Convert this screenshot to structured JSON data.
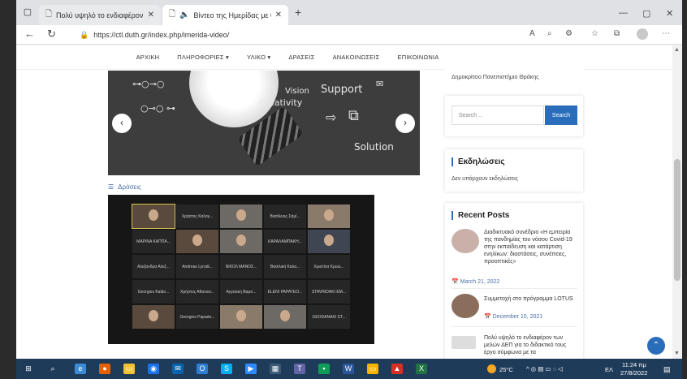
{
  "browser": {
    "tabs": [
      {
        "title": "Πολύ υψηλό το ενδιαφέρον τω",
        "active": false
      },
      {
        "title": "Βίντεο της Ημερίδας με θέ",
        "active": true
      }
    ],
    "url": "https://ctl.duth.gr/index.php/imerida-video/"
  },
  "menu": {
    "items": [
      "ΑΡΧΙΚΗ",
      "ΠΛΗΡΟΦΟΡΙΕΣ ▾",
      "ΥΛΙΚΟ ▾",
      "ΔΡΑΣΕΙΣ",
      "ΑΝΑΚΟΙΝΩΣΕΙΣ",
      "ΕΠΙΚΟΙΝΩΝΙΑ"
    ]
  },
  "slider": {
    "words": [
      "Vision",
      "Creativity",
      "Support",
      "Solution"
    ]
  },
  "content": {
    "category": "Δράσεις"
  },
  "video": {
    "participants": [
      "",
      "Χρήστος Καλογ...",
      "",
      "Βασίλειος Σαμί...",
      "",
      "ΜΑΡΙΝΑ ΚΑΠΠΑ...",
      "",
      "",
      "ΚΑΡΑΛΑΜΠΑΚΗ...",
      "",
      "Αλεξανδρα Αλεξ...",
      "Andreas Lyrodi...",
      "ΝΙΚΟΛ ΜΑΝΟΣ...",
      "Βασιλική Καλα...",
      "Χριστίνα Κρυώ...",
      "Georgios Kaibo...",
      "Χρήστος Αθανασ...",
      "Αγγελικη Βαρσ...",
      "ELENI PAPATEO...",
      "STAVRIDAKI EM...",
      "",
      "Georgios Papado...",
      "",
      "",
      "GEODANAKI ST..."
    ]
  },
  "sidebar": {
    "university": "Δημοκρίτειο Πανεπιστήμιο Θράκης",
    "search_placeholder": "Search ...",
    "search_button": "Search",
    "events_title": "Εκδηλώσεις",
    "events_text": "Δεν υπάρχουν εκδηλώσεις",
    "recent_title": "Recent Posts",
    "posts": [
      {
        "title": "Διαδικτυακό συνέδριο «Η εμπειρία της πανδημίας του νόσου Covid-19 στην εκπαίδευση και κατάρτιση ενηλίκων: διαστάσεις, συνέπειες, προοπτικές»",
        "date": "March 21, 2022"
      },
      {
        "title": "Συμμετοχή στο πρόγραμμα LOTUS",
        "date": "December 10, 2021"
      },
      {
        "title": "Πολύ υψηλό το ενδιαφέρον των μελών ΔΕΠ για το διδακτικό τους έργο σύμφωνα με τα",
        "date": ""
      }
    ]
  },
  "taskbar": {
    "temperature": "25°C",
    "language": "ΕΛ",
    "time": "11:24 πμ",
    "date": "27/8/2022"
  },
  "colors": {
    "accent": "#2a6ebb",
    "taskbar": "#1f3b5a",
    "video_bg": "#161616"
  }
}
